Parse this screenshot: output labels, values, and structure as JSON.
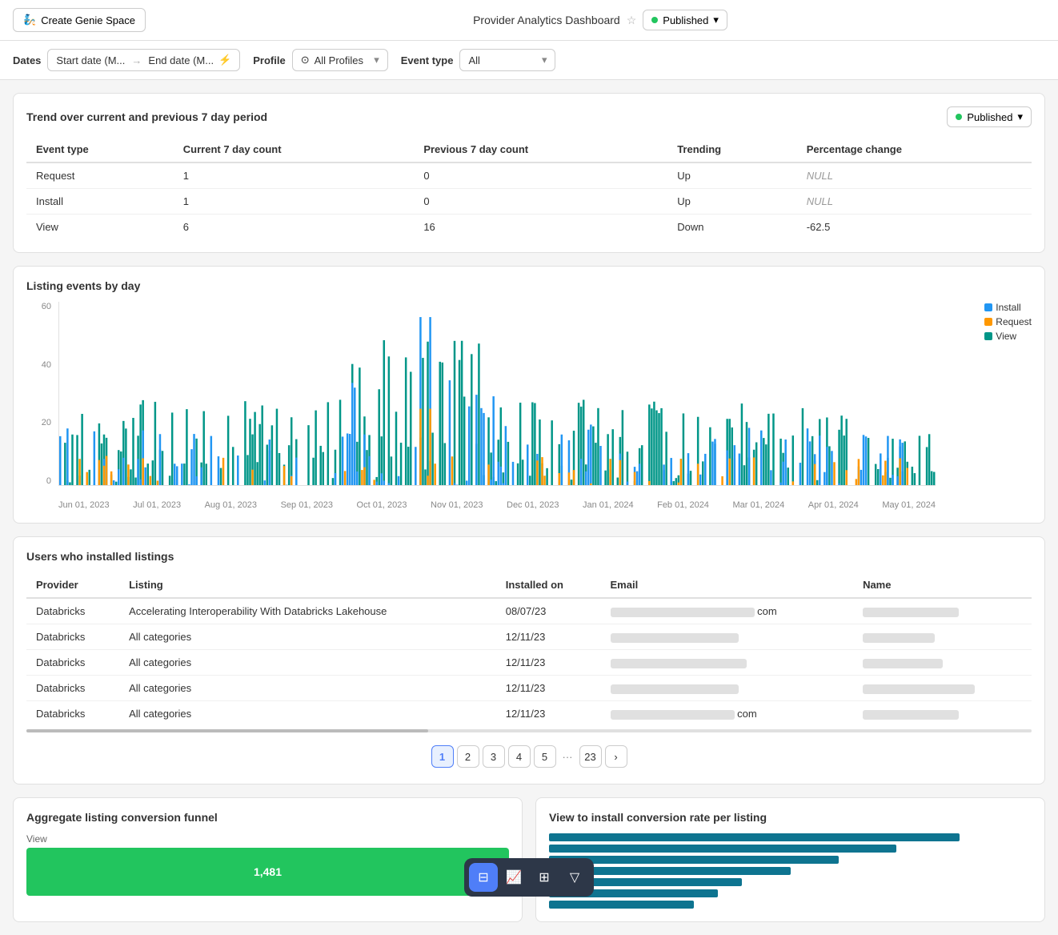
{
  "header": {
    "create_btn": "Create Genie Space",
    "dashboard_title": "Provider Analytics Dashboard",
    "published_label": "Published"
  },
  "filters": {
    "dates_label": "Dates",
    "start_placeholder": "Start date (M...",
    "arrow": "→",
    "end_placeholder": "End date (M...",
    "profile_label": "Profile",
    "profile_value": "All Profiles",
    "event_type_label": "Event type",
    "event_type_value": "All"
  },
  "trend_section": {
    "title": "Trend over current and previous 7 day period",
    "published_label": "Published",
    "columns": [
      "Event type",
      "Current 7 day count",
      "Previous 7 day count",
      "Trending",
      "Percentage change"
    ],
    "rows": [
      {
        "event_type": "Request",
        "current": "1",
        "previous": "0",
        "trending": "Up",
        "pct": "NULL"
      },
      {
        "event_type": "Install",
        "current": "1",
        "previous": "0",
        "trending": "Up",
        "pct": "NULL"
      },
      {
        "event_type": "View",
        "current": "6",
        "previous": "16",
        "trending": "Down",
        "pct": "-62.5"
      }
    ]
  },
  "chart": {
    "title": "Listing events by day",
    "y_labels": [
      "60",
      "40",
      "20",
      "0"
    ],
    "x_labels": [
      "Jun 01, 2023",
      "Jul 01, 2023",
      "Aug 01, 2023",
      "Sep 01, 2023",
      "Oct 01, 2023",
      "Nov 01, 2023",
      "Dec 01, 2023",
      "Jan 01, 2024",
      "Feb 01, 2024",
      "Mar 01, 2024",
      "Apr 01, 2024",
      "May 01, 2024"
    ],
    "legend": [
      {
        "label": "Install",
        "color": "#2196f3"
      },
      {
        "label": "Request",
        "color": "#ff9800"
      },
      {
        "label": "View",
        "color": "#009688"
      }
    ]
  },
  "users_section": {
    "title": "Users who installed listings",
    "columns": [
      "Provider",
      "Listing",
      "Installed on",
      "Email",
      "Name"
    ],
    "rows": [
      {
        "provider": "Databricks",
        "listing": "Accelerating Interoperability With Databricks Lakehouse",
        "installed": "08/07/23",
        "email_blur": 180,
        "name_blur": 120
      },
      {
        "provider": "Databricks",
        "listing": "All categories",
        "installed": "12/11/23",
        "email_blur": 160,
        "name_blur": 90
      },
      {
        "provider": "Databricks",
        "listing": "All categories",
        "installed": "12/11/23",
        "email_blur": 170,
        "name_blur": 100
      },
      {
        "provider": "Databricks",
        "listing": "All categories",
        "installed": "12/11/23",
        "email_blur": 160,
        "name_blur": 140
      },
      {
        "provider": "Databricks",
        "listing": "All categories",
        "installed": "12/11/23",
        "email_blur": 155,
        "name_blur": 120
      }
    ]
  },
  "pagination": {
    "pages": [
      "1",
      "2",
      "3",
      "4",
      "5"
    ],
    "ellipsis": "···",
    "last_page": "23",
    "active": "1"
  },
  "aggregate": {
    "title": "Aggregate listing conversion funnel",
    "view_label": "View",
    "view_value": "1,481"
  },
  "conversion": {
    "title": "View to install conversion rate per listing"
  },
  "toolbar": {
    "icons": [
      "filter",
      "chart",
      "table",
      "funnel"
    ]
  }
}
